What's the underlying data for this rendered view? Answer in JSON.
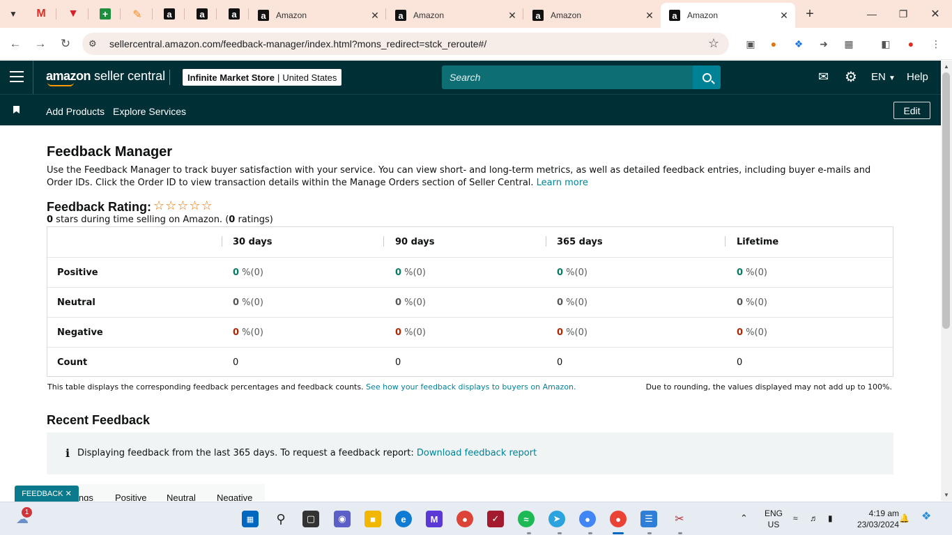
{
  "browser": {
    "tabs": [
      {
        "title": "Amazon",
        "active": false
      },
      {
        "title": "Amazon",
        "active": false
      },
      {
        "title": "Amazon",
        "active": false
      },
      {
        "title": "Amazon",
        "active": true
      }
    ],
    "url": "sellercentral.amazon.com/feedback-manager/index.html?mons_redirect=stck_reroute#/"
  },
  "header": {
    "brand": "amazon",
    "brand_suffix": " seller central",
    "store_name": "Infinite Market Store",
    "store_region": "United States",
    "search_placeholder": "Search",
    "language": "EN",
    "help": "Help"
  },
  "subheader": {
    "links": [
      "Add Products",
      "Explore Services"
    ],
    "edit_label": "Edit"
  },
  "page": {
    "title": "Feedback Manager",
    "intro": "Use the Feedback Manager to track buyer satisfaction with your service. You can view short- and long-term metrics, as well as detailed feedback entries, including buyer e-mails and Order IDs. Click the Order ID to view transaction details within the Manage Orders section of Seller Central.",
    "learn_more": "Learn more",
    "rating_title": "Feedback Rating:",
    "stars_filled": 0,
    "stars_total": 5,
    "stars_value": "0",
    "stars_text_mid": " stars during time selling on Amazon. (",
    "ratings_count": "0",
    "ratings_suffix": " ratings)"
  },
  "table": {
    "columns": [
      "30 days",
      "90 days",
      "365 days",
      "Lifetime"
    ],
    "rows": [
      {
        "label": "Positive",
        "tone": "positive",
        "values": [
          "0",
          "0",
          "0",
          "0"
        ],
        "suffix": " %(0)"
      },
      {
        "label": "Neutral",
        "tone": "neutral",
        "values": [
          "0",
          "0",
          "0",
          "0"
        ],
        "suffix": " %(0)"
      },
      {
        "label": "Negative",
        "tone": "negative",
        "values": [
          "0",
          "0",
          "0",
          "0"
        ],
        "suffix": " %(0)"
      },
      {
        "label": "Count",
        "tone": "count",
        "values": [
          "0",
          "0",
          "0",
          "0"
        ],
        "suffix": ""
      }
    ],
    "footnote_left": "This table displays the corresponding feedback percentages and feedback counts.",
    "footnote_link": "See how your feedback displays to buyers on Amazon.",
    "footnote_right": "Due to rounding, the values displayed may not add up to 100%."
  },
  "recent": {
    "title": "Recent Feedback",
    "info_text": "Displaying feedback from the last 365 days. To request a feedback report:",
    "info_link": "Download feedback report",
    "tabs": [
      "ings",
      "Positive",
      "Neutral",
      "Negative"
    ],
    "feedback_pill": "FEEDBACK"
  },
  "taskbar": {
    "notification_count": "1",
    "lang_line1": "ENG",
    "lang_line2": "US",
    "time": "4:19 am",
    "date": "23/03/2024"
  },
  "colors": {
    "header_bg": "#002f36",
    "link": "#008296",
    "positive": "#067d62",
    "negative": "#b12704",
    "star": "#e77600"
  }
}
